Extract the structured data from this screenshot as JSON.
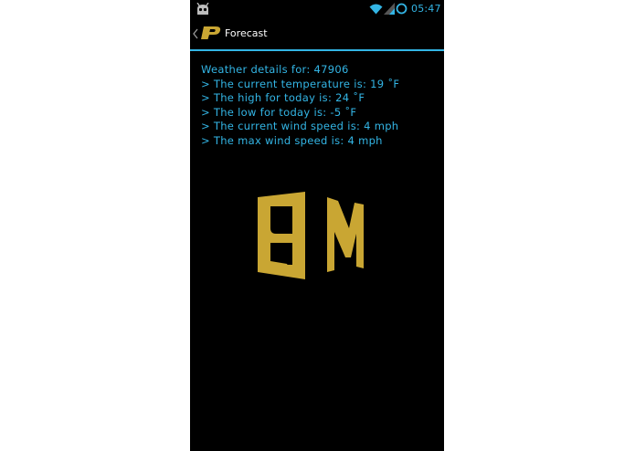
{
  "status_bar": {
    "time": "05:47",
    "icons": [
      "android-icon",
      "wifi-icon",
      "signal-icon",
      "battery-ring-icon"
    ],
    "accent_color": "#33b5e5"
  },
  "action_bar": {
    "title": "Forecast",
    "icons": [
      "chevron-left-icon",
      "purdue-p-logo-icon"
    ]
  },
  "weather": {
    "header": "Weather details for: 47906",
    "lines": [
      "> The current temperature is: 19 ˚F",
      "> The high for today is: 24 ˚F",
      "> The low for today is: -5 ˚F",
      "> The current wind speed is: 4 mph",
      "> The max wind speed is: 4 mph"
    ]
  },
  "graphic": {
    "name": "rotating-bm-logo",
    "letters": "BM",
    "color": "#c9a633"
  }
}
